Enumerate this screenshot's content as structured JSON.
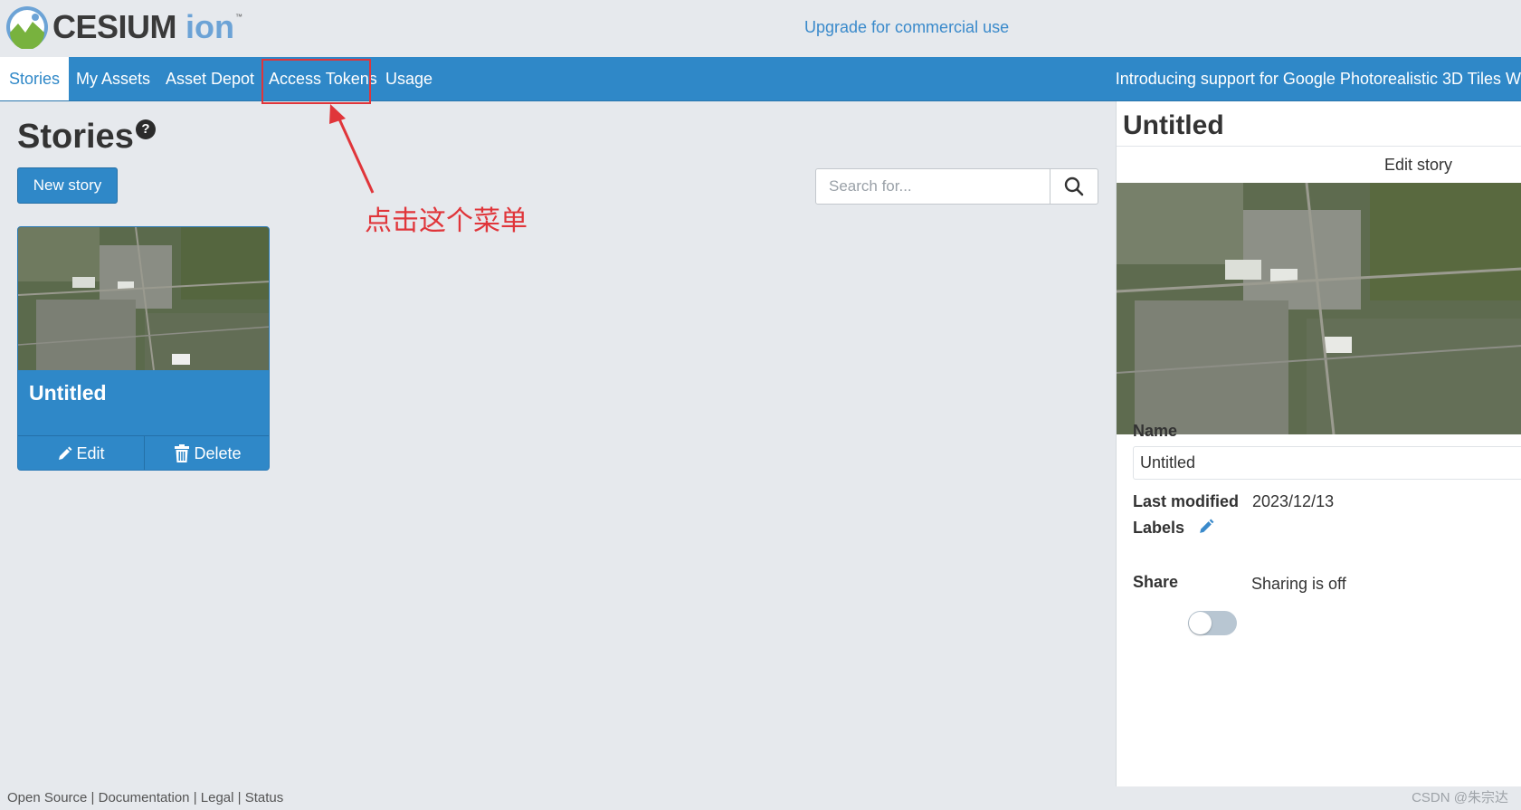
{
  "header": {
    "logo_text": "CESIUM",
    "logo_ion": "ion",
    "logo_tm": "™",
    "upgrade_link": "Upgrade for commercial use"
  },
  "nav": {
    "items": [
      {
        "label": "Stories",
        "active": true
      },
      {
        "label": "My Assets",
        "active": false
      },
      {
        "label": "Asset Depot",
        "active": false
      },
      {
        "label": "Access Tokens",
        "active": false
      },
      {
        "label": "Usage",
        "active": false
      }
    ],
    "announcement": "Introducing support for Google Photorealistic 3D Tiles  W"
  },
  "annotation": {
    "text": "点击这个菜单",
    "color": "#e0353a"
  },
  "main": {
    "title": "Stories",
    "help": "?",
    "new_story_label": "New story",
    "search_placeholder": "Search for..."
  },
  "cards": [
    {
      "title": "Untitled",
      "edit_label": "Edit",
      "delete_label": "Delete"
    }
  ],
  "panel": {
    "title": "Untitled",
    "edit_story_label": "Edit story",
    "name_label": "Name",
    "name_value": "Untitled",
    "last_modified_label": "Last modified",
    "last_modified_value": "2023/12/13",
    "labels_label": "Labels",
    "share_label": "Share",
    "share_status": "Sharing is off",
    "share_enabled": false
  },
  "footer": {
    "links": [
      "Open Source",
      "Documentation",
      "Legal",
      "Status"
    ],
    "separator": " | ",
    "watermark": "CSDN @朱宗达"
  },
  "colors": {
    "accent": "#2f88c8",
    "background": "#e6e9ed",
    "annotation": "#e0353a"
  }
}
